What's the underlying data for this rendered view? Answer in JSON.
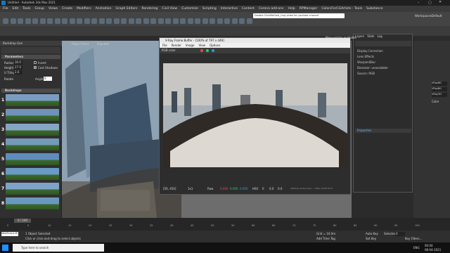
{
  "window": {
    "title": "Untitled - Autodesk 3ds Max 2021"
  },
  "menu": {
    "items": [
      "File",
      "Edit",
      "Tools",
      "Group",
      "Views",
      "Create",
      "Modifiers",
      "Animation",
      "Graph Editors",
      "Rendering",
      "Civil View",
      "Customize",
      "Scripting",
      "Interactive",
      "Content",
      "Corona add-ons",
      "Help",
      "RPManager",
      "ColorsForCGArtists - Tools",
      "Substance"
    ],
    "search_placeholder": "Double-ClickMeGold_Ling video for youtube channel",
    "workspace_label": "Workspaces",
    "workspace_value": "Default"
  },
  "left_panel": {
    "title": "Backdrop Gen",
    "params_header": "Parameters",
    "radius_label": "Radius",
    "radius_value": "30.0",
    "height_label": "Height",
    "height_value": "27.0",
    "uvtiling_label": "U Tiling",
    "uvtiling_value": "2.0",
    "invert_label": "Invert",
    "cast_shadows_label": "Cast Shadows",
    "rotate_label": "Rotate",
    "angle_label": "Angle",
    "angle_value": "0",
    "backdrops_header": "Backdrops",
    "rows": [
      "1",
      "2",
      "3",
      "4",
      "5",
      "6",
      "7",
      "8"
    ]
  },
  "viewport": {
    "label": "Object Paint",
    "populate_label": "Populate"
  },
  "vfb": {
    "title": "V-Ray Frame Buffer - [100% of 797 x 449]",
    "menus": [
      "File",
      "Render",
      "Image",
      "View",
      "Options"
    ],
    "channel": "RGB color",
    "coords": "[56, 454]",
    "mode": "1x1",
    "raw_label": "Raw",
    "vals": [
      "0.000",
      "0.000",
      "0.000"
    ],
    "hsv_label": "HSV",
    "hsv_vals": [
      "0",
      "0.0",
      "0.0"
    ],
    "status": "lighting render pass — Step: 00:00:00.0"
  },
  "layers": {
    "new_version": "New version available",
    "tabs": [
      "Layers",
      "Stats",
      "Log"
    ],
    "items": [
      "Display Correction",
      "Lens Effects",
      "Sharpen/Blur",
      "Denoiser: unavailable",
      "Source: RGB"
    ],
    "properties": "Properties"
  },
  "right_panel": {
    "color_label": "Color",
    "vals": [
      "VRayBG",
      "VRayBG",
      "VRay3D"
    ]
  },
  "timeline": {
    "frame": "0 / 100",
    "ticks": [
      "0",
      "5",
      "10",
      "15",
      "20",
      "25",
      "30",
      "35",
      "40",
      "45",
      "50",
      "55",
      "60",
      "65",
      "70",
      "75",
      "80",
      "85",
      "90",
      "95",
      "100"
    ]
  },
  "statusbar": {
    "selection": "1 Object Selected",
    "prompt": "Click or click-and-drag to select objects",
    "grid": "Grid = 10.0m",
    "add_time_tag": "Add Time Tag",
    "auto_key": "Auto Key",
    "set_key": "Set Key",
    "key_filters": "Key Filters...",
    "selected_label": "Selected",
    "frame_field": "0",
    "maxscript": "MAXScript Mi"
  },
  "taskbar": {
    "search_placeholder": "Type here to search",
    "time": "00:04",
    "date": "08-04-2021",
    "lang": "ENG"
  },
  "colors": {
    "accent": "#4a90d9",
    "keyred": "#c0392b"
  }
}
